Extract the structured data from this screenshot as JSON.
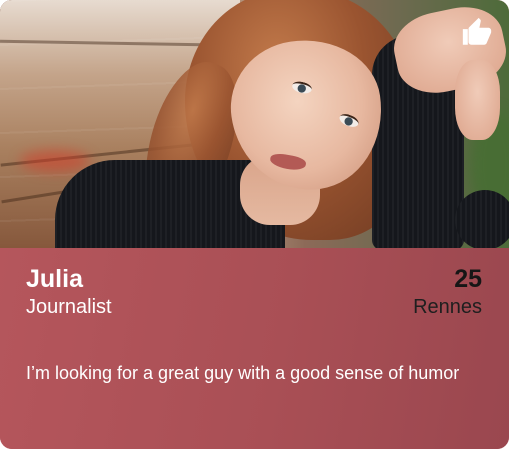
{
  "profile": {
    "name": "Julia",
    "age": "25",
    "profession": "Journalist",
    "city": "Rennes",
    "bio": "I’m looking for a great guy with a good sense of humor"
  },
  "icons": {
    "like": "thumbs-up-icon"
  },
  "colors": {
    "panel": "#b05258",
    "name_text": "#ffffff",
    "age_text": "#161616"
  }
}
